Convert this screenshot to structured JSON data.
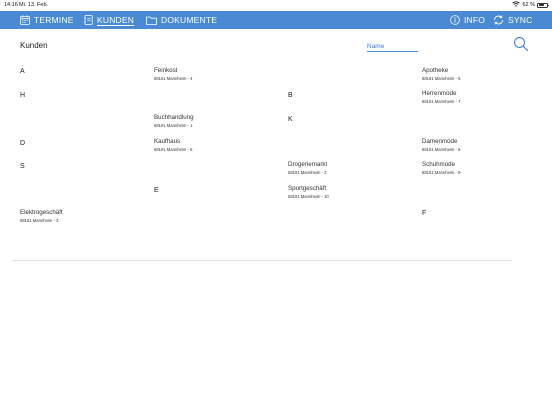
{
  "status_bar": {
    "time": "14:16",
    "date": "Mi. 13. Feb.",
    "battery": "62 %",
    "battery_level": 0.62
  },
  "nav": {
    "termine": "TERMINE",
    "kunden": "KUNDEN",
    "dokumente": "DOKUMENTE",
    "info": "INFO",
    "sync": "SYNC",
    "active_tab": "kunden",
    "bar_color": "#4a8ad5"
  },
  "page": {
    "title": "Kunden",
    "name_placeholder": "Name",
    "accent": "#3a7bd5"
  },
  "grid": {
    "c0": {
      "letters": [
        "A",
        "H",
        "D",
        "S"
      ],
      "entries": [
        {
          "name": "Elektrogeschäft",
          "addr": "68161 Mannheim - 3"
        }
      ]
    },
    "c1": {
      "entries": [
        {
          "name": "Feinkost",
          "addr": "68161 Mannheim - 4"
        },
        {
          "name": "Buchhandlung",
          "addr": "68161 Mannheim - 1"
        },
        {
          "name": "Kaufhaus",
          "addr": "68161 Mannheim - 6"
        }
      ],
      "letters": [
        "E"
      ]
    },
    "c2": {
      "letters": [
        "B",
        "K"
      ],
      "entries": [
        {
          "name": "Drogeriemarkt",
          "addr": "68161 Mannheim - 2"
        },
        {
          "name": "Sportgeschäft",
          "addr": "68161 Mannheim - 10"
        }
      ]
    },
    "c3": {
      "entries": [
        {
          "name": "Apotheke",
          "addr": "68161 Mannheim - 5"
        },
        {
          "name": "Herrenmode",
          "addr": "68161 Mannheim - 7"
        },
        {
          "name": "Damenmode",
          "addr": "68161 Mannheim - 8"
        },
        {
          "name": "Schuhmode",
          "addr": "68161 Mannheim - 9"
        }
      ],
      "letters": [
        "F"
      ]
    }
  }
}
